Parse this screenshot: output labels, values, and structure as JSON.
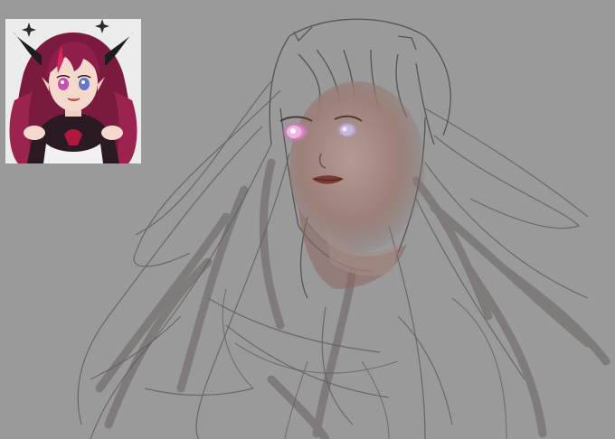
{
  "app": {
    "view": "painting-canvas"
  },
  "reference": {
    "subject": "anime-girl-reference",
    "colors": {
      "background": "#ececec",
      "hair": "#8e1f4a",
      "hair_highlight": "#d8265c",
      "horns": "#1d1d1f",
      "skin": "#f4d9cc",
      "outfit_dark": "#2a1a24",
      "outfit_white": "#f2f0f3",
      "eye_left": "#c94fb4",
      "eye_right": "#5f78c8"
    }
  },
  "canvas": {
    "colors": {
      "background": "#9a9a9a",
      "sketch_line": "#5e5c5c",
      "shadow_stroke": "#7c7676",
      "skin_base": "#a58c84",
      "skin_shadow": "#8c6660",
      "lips": "#7a3b35",
      "eye_glow": "#e7a3d6"
    }
  }
}
